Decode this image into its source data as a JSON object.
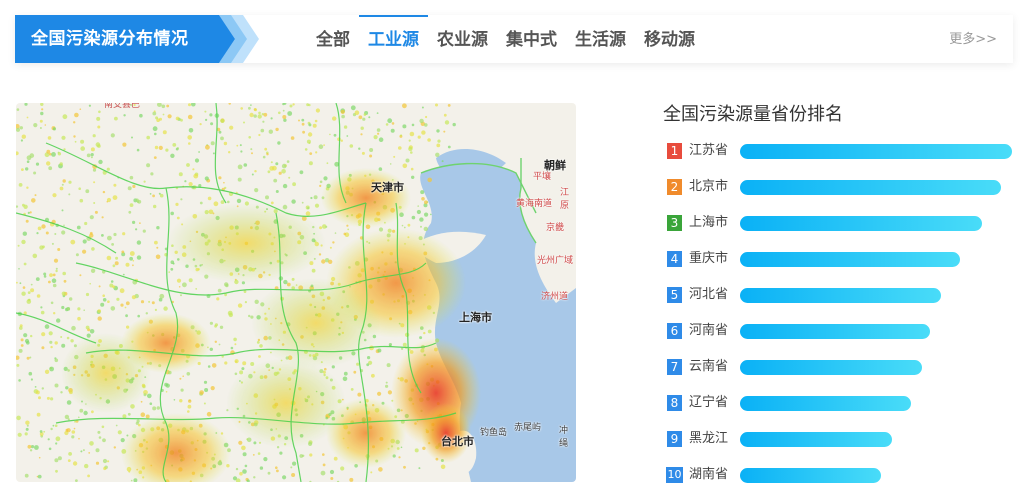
{
  "header": {
    "title": "全国污染源分布情况",
    "tabs": [
      {
        "label": "全部",
        "active": false
      },
      {
        "label": "工业源",
        "active": true
      },
      {
        "label": "农业源",
        "active": false
      },
      {
        "label": "集中式",
        "active": false
      },
      {
        "label": "生活源",
        "active": false
      },
      {
        "label": "移动源",
        "active": false
      }
    ],
    "more_label": "更多>>"
  },
  "map": {
    "labels": {
      "tianjin": "天津市",
      "shanghai": "上海市",
      "taibei": "台北市",
      "chaoxian": "朝鲜",
      "pingrang": "平壤",
      "jiangyuan": "江原",
      "huanghainandao": "黄海南道",
      "jingji": "京畿",
      "guangzhouhu": "光州广域",
      "jizhoudao": "济州道",
      "diaoyudao": "钓鱼岛",
      "chiweiyu": "赤尾屿",
      "chongsheng": "冲绳"
    }
  },
  "ranking": {
    "title": "全国污染源量省份排名",
    "items": [
      {
        "rank": "1",
        "name": "江苏省",
        "value": 1.0,
        "color": "#e84c3d"
      },
      {
        "rank": "2",
        "name": "北京市",
        "value": 0.96,
        "color": "#f08b2c"
      },
      {
        "rank": "3",
        "name": "上海市",
        "value": 0.89,
        "color": "#3aa53a"
      },
      {
        "rank": "4",
        "name": "重庆市",
        "value": 0.81,
        "color": "#2f8be8"
      },
      {
        "rank": "5",
        "name": "河北省",
        "value": 0.74,
        "color": "#2f8be8"
      },
      {
        "rank": "6",
        "name": "河南省",
        "value": 0.7,
        "color": "#2f8be8"
      },
      {
        "rank": "7",
        "name": "云南省",
        "value": 0.67,
        "color": "#2f8be8"
      },
      {
        "rank": "8",
        "name": "辽宁省",
        "value": 0.63,
        "color": "#2f8be8"
      },
      {
        "rank": "9",
        "name": "黑龙江",
        "value": 0.56,
        "color": "#2f8be8"
      },
      {
        "rank": "10",
        "name": "湖南省",
        "value": 0.52,
        "color": "#2f8be8"
      }
    ]
  }
}
